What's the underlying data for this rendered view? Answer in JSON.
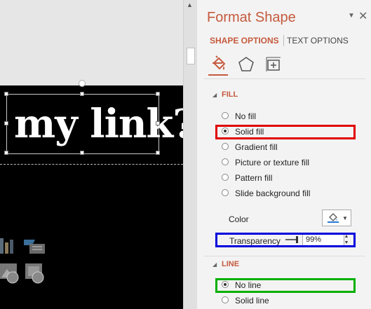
{
  "slide": {
    "text": "my link?"
  },
  "panel": {
    "title": "Format Shape",
    "tabs": [
      {
        "label": "SHAPE OPTIONS"
      },
      {
        "label": "TEXT OPTIONS"
      }
    ],
    "icons": [
      "fill-line-icon",
      "effects-icon",
      "size-properties-icon"
    ],
    "fill": {
      "header": "FILL",
      "options": [
        {
          "label": "No fill",
          "checked": false
        },
        {
          "label": "Solid fill",
          "checked": true
        },
        {
          "label": "Gradient fill",
          "checked": false
        },
        {
          "label": "Picture or texture fill",
          "checked": false
        },
        {
          "label": "Pattern fill",
          "checked": false
        },
        {
          "label": "Slide background fill",
          "checked": false
        }
      ],
      "color_label": "Color",
      "transparency_label": "Transparency",
      "transparency_value": "99%"
    },
    "line": {
      "header": "LINE",
      "options": [
        {
          "label": "No line",
          "checked": true
        },
        {
          "label": "Solid line",
          "checked": false
        }
      ]
    }
  },
  "colors": {
    "accent": "#c55a3e",
    "highlight_red": "#e00000",
    "highlight_blue": "#0000dd",
    "highlight_green": "#00b000"
  }
}
